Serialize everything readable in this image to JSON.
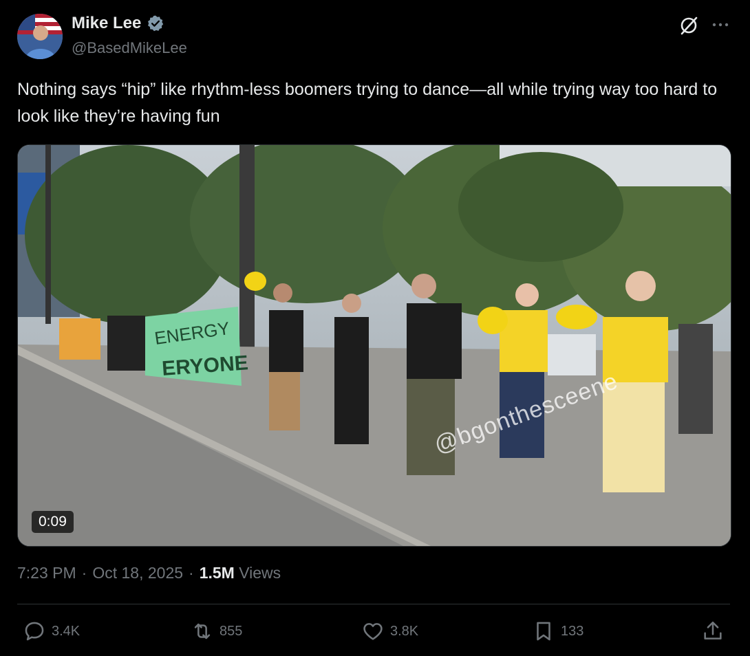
{
  "author": {
    "name": "Mike Lee",
    "handle": "@BasedMikeLee"
  },
  "tweet": {
    "text": "Nothing says “hip” like rhythm-less  boomers trying to dance—all while trying way too hard to look like they’re having fun"
  },
  "video": {
    "duration": "0:09",
    "watermark": "@bgonthesceene",
    "banner_text": "ENERGY\nERYONE"
  },
  "meta": {
    "time": "7:23 PM",
    "date": "Oct 18, 2025",
    "separator": "·",
    "views_count": "1.5M",
    "views_label": "Views"
  },
  "actions": {
    "replies": "3.4K",
    "reposts": "855",
    "likes": "3.8K",
    "bookmarks": "133"
  },
  "colors": {
    "background": "#000000",
    "text": "#e7e9ea",
    "muted": "#71767b",
    "verified": "#829aab"
  },
  "icons": [
    "verified-badge-icon",
    "grok-icon",
    "more-icon",
    "reply-icon",
    "repost-icon",
    "like-icon",
    "bookmark-icon",
    "share-icon"
  ]
}
